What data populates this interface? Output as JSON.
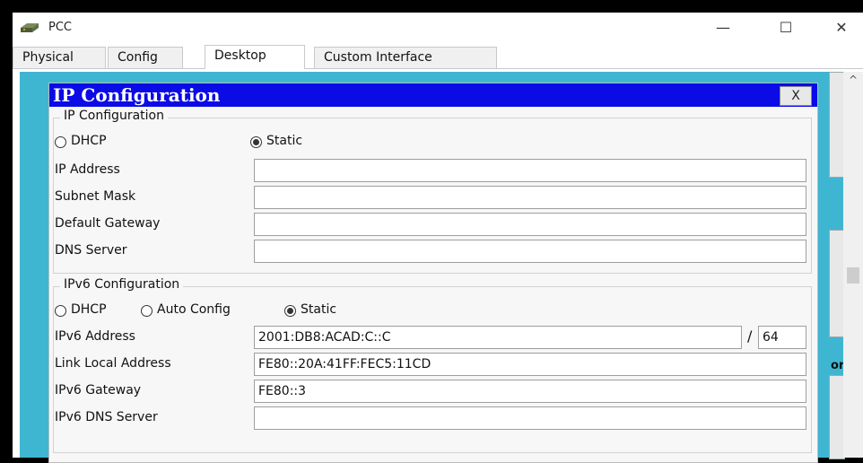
{
  "window": {
    "title": "PCC",
    "minimize_glyph": "—",
    "maximize_glyph": "☐",
    "close_glyph": "✕",
    "app_icon": "network-device-icon"
  },
  "tabs": [
    {
      "label": "Physical"
    },
    {
      "label": "Config"
    },
    {
      "label": "Desktop",
      "active": true
    },
    {
      "label": "Custom Interface"
    }
  ],
  "background": {
    "partial_text": "or",
    "scroll_up_glyph": "^"
  },
  "dialog": {
    "title": "IP Configuration",
    "close_label": "X",
    "ipv4": {
      "legend": "IP Configuration",
      "dhcp_label": "DHCP",
      "static_label": "Static",
      "mode": "static",
      "fields": {
        "ip_address": {
          "label": "IP Address",
          "value": ""
        },
        "subnet_mask": {
          "label": "Subnet Mask",
          "value": ""
        },
        "default_gateway": {
          "label": "Default Gateway",
          "value": ""
        },
        "dns_server": {
          "label": "DNS Server",
          "value": ""
        }
      }
    },
    "ipv6": {
      "legend": "IPv6 Configuration",
      "dhcp_label": "DHCP",
      "auto_config_label": "Auto Config",
      "static_label": "Static",
      "mode": "static",
      "fields": {
        "ipv6_address": {
          "label": "IPv6 Address",
          "value": "2001:DB8:ACAD:C::C",
          "prefix_separator": "/",
          "prefix": "64"
        },
        "link_local_address": {
          "label": "Link Local Address",
          "value": "FE80::20A:41FF:FEC5:11CD"
        },
        "ipv6_gateway": {
          "label": "IPv6 Gateway",
          "value": "FE80::3"
        },
        "ipv6_dns_server": {
          "label": "IPv6 DNS Server",
          "value": ""
        }
      }
    }
  },
  "colors": {
    "dialog_header": "#0b0be6",
    "desktop_background": "#3fb6d1"
  }
}
